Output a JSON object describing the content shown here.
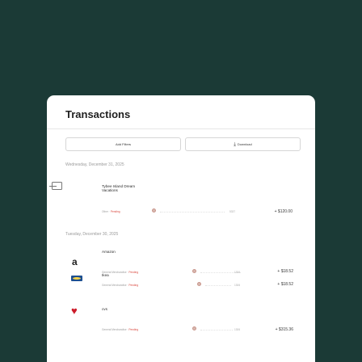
{
  "card": {
    "title": "Transactions"
  },
  "toolbar": {
    "filters_label": "Add Filters",
    "download_label": "Download"
  },
  "groups": [
    {
      "date": "Wednesday, December 31, 2025",
      "transactions": [
        {
          "icon": "calendar-icon",
          "name_line1": "Tybee Island Dream",
          "name_line2": "Vacations",
          "category": "Other",
          "status": "Pending",
          "account": "5337",
          "amount": "+ $120.00"
        }
      ]
    },
    {
      "date": "Tuesday, December 30, 2025",
      "transactions": [
        {
          "icon": "amazon-logo",
          "logo_text": "a",
          "name_line1": "Amazon",
          "category": "General Merchandise",
          "status": "Pending",
          "account": "1306",
          "amount": "+ $18.52"
        },
        {
          "icon": "ikea-logo",
          "name_line1": "Ikea",
          "category": "General Merchandise",
          "status": "Pending",
          "account": "1306",
          "amount": "+ $18.52"
        },
        {
          "icon": "cvs-logo",
          "logo_text": "♥",
          "name_line1": "cvs",
          "category": "General Merchandise",
          "status": "Pending",
          "account": "1306",
          "amount": "+ $315.36"
        }
      ]
    }
  ],
  "separator": " · "
}
